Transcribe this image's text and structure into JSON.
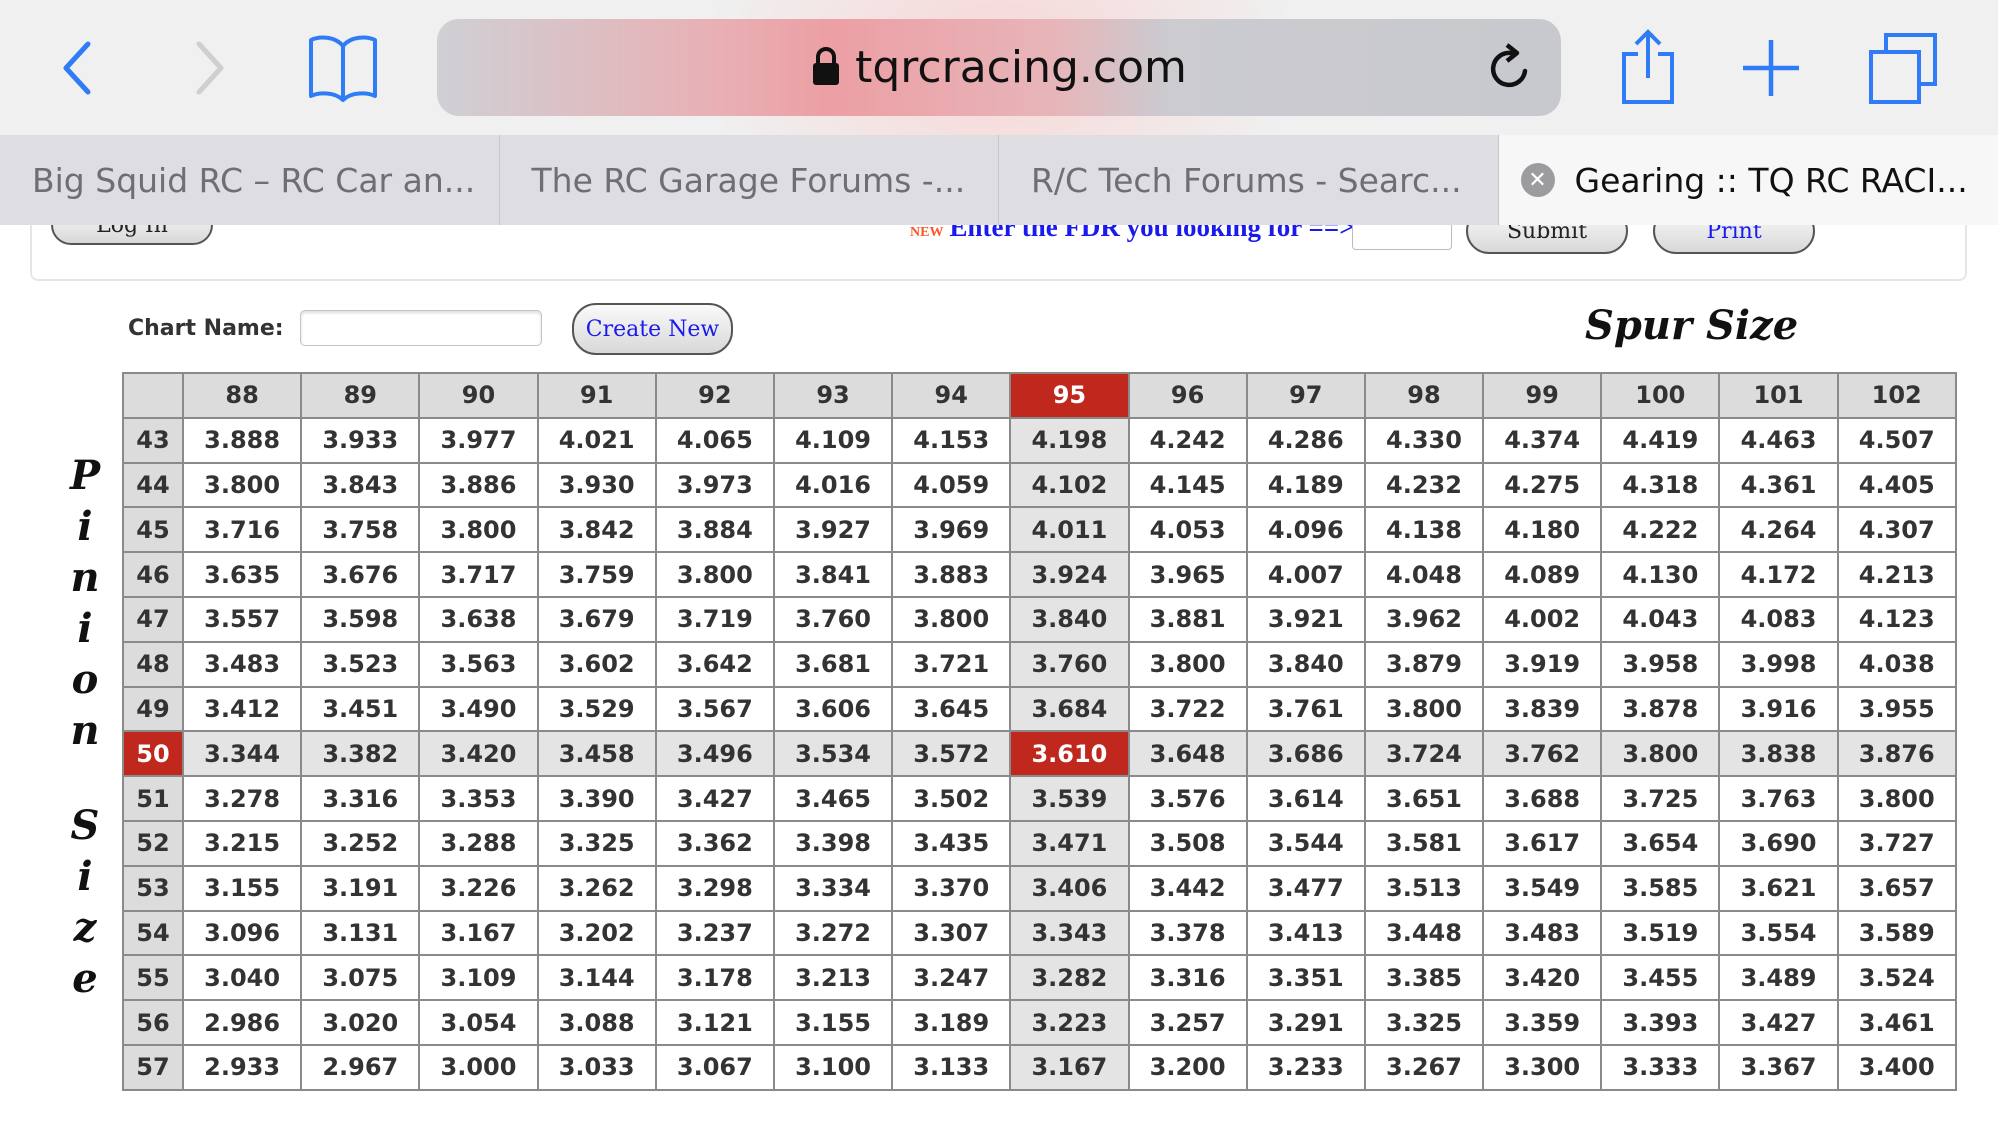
{
  "browser": {
    "url": "tqrcracing.com",
    "icons": [
      "back-icon",
      "forward-icon",
      "bookmarks-icon",
      "lock-icon",
      "reload-icon",
      "share-icon",
      "new-tab-icon",
      "tabs-icon"
    ],
    "tabs": [
      {
        "label": "Big Squid RC – RC Car an..."
      },
      {
        "label": "The RC Garage Forums -..."
      },
      {
        "label": "R/C Tech Forums - Searc..."
      },
      {
        "label": "Gearing :: TQ RC RACI...",
        "active": true
      }
    ]
  },
  "top": {
    "login_label": "Log In",
    "new_badge": "NEW",
    "fdr_prompt": "Enter the FDR you looking for ==>",
    "fdr_value": "",
    "submit_label": "Submit",
    "print_label": "Print"
  },
  "chart_form": {
    "label": "Chart Name:",
    "value": "",
    "create_label": "Create New"
  },
  "table": {
    "spur_title": "Spur Size",
    "pinion_title": [
      "P",
      "i",
      "n",
      "i",
      "o",
      "n",
      "",
      "S",
      "i",
      "z",
      "e"
    ],
    "highlight_color": "#c0281e",
    "selected_spur": "95",
    "selected_pinion": "50",
    "spurs": [
      "88",
      "89",
      "90",
      "91",
      "92",
      "93",
      "94",
      "95",
      "96",
      "97",
      "98",
      "99",
      "100",
      "101",
      "102"
    ],
    "rows": [
      {
        "pinion": "43",
        "values": [
          "3.888",
          "3.933",
          "3.977",
          "4.021",
          "4.065",
          "4.109",
          "4.153",
          "4.198",
          "4.242",
          "4.286",
          "4.330",
          "4.374",
          "4.419",
          "4.463",
          "4.507"
        ]
      },
      {
        "pinion": "44",
        "values": [
          "3.800",
          "3.843",
          "3.886",
          "3.930",
          "3.973",
          "4.016",
          "4.059",
          "4.102",
          "4.145",
          "4.189",
          "4.232",
          "4.275",
          "4.318",
          "4.361",
          "4.405"
        ]
      },
      {
        "pinion": "45",
        "values": [
          "3.716",
          "3.758",
          "3.800",
          "3.842",
          "3.884",
          "3.927",
          "3.969",
          "4.011",
          "4.053",
          "4.096",
          "4.138",
          "4.180",
          "4.222",
          "4.264",
          "4.307"
        ]
      },
      {
        "pinion": "46",
        "values": [
          "3.635",
          "3.676",
          "3.717",
          "3.759",
          "3.800",
          "3.841",
          "3.883",
          "3.924",
          "3.965",
          "4.007",
          "4.048",
          "4.089",
          "4.130",
          "4.172",
          "4.213"
        ]
      },
      {
        "pinion": "47",
        "values": [
          "3.557",
          "3.598",
          "3.638",
          "3.679",
          "3.719",
          "3.760",
          "3.800",
          "3.840",
          "3.881",
          "3.921",
          "3.962",
          "4.002",
          "4.043",
          "4.083",
          "4.123"
        ]
      },
      {
        "pinion": "48",
        "values": [
          "3.483",
          "3.523",
          "3.563",
          "3.602",
          "3.642",
          "3.681",
          "3.721",
          "3.760",
          "3.800",
          "3.840",
          "3.879",
          "3.919",
          "3.958",
          "3.998",
          "4.038"
        ]
      },
      {
        "pinion": "49",
        "values": [
          "3.412",
          "3.451",
          "3.490",
          "3.529",
          "3.567",
          "3.606",
          "3.645",
          "3.684",
          "3.722",
          "3.761",
          "3.800",
          "3.839",
          "3.878",
          "3.916",
          "3.955"
        ]
      },
      {
        "pinion": "50",
        "values": [
          "3.344",
          "3.382",
          "3.420",
          "3.458",
          "3.496",
          "3.534",
          "3.572",
          "3.610",
          "3.648",
          "3.686",
          "3.724",
          "3.762",
          "3.800",
          "3.838",
          "3.876"
        ]
      },
      {
        "pinion": "51",
        "values": [
          "3.278",
          "3.316",
          "3.353",
          "3.390",
          "3.427",
          "3.465",
          "3.502",
          "3.539",
          "3.576",
          "3.614",
          "3.651",
          "3.688",
          "3.725",
          "3.763",
          "3.800"
        ]
      },
      {
        "pinion": "52",
        "values": [
          "3.215",
          "3.252",
          "3.288",
          "3.325",
          "3.362",
          "3.398",
          "3.435",
          "3.471",
          "3.508",
          "3.544",
          "3.581",
          "3.617",
          "3.654",
          "3.690",
          "3.727"
        ]
      },
      {
        "pinion": "53",
        "values": [
          "3.155",
          "3.191",
          "3.226",
          "3.262",
          "3.298",
          "3.334",
          "3.370",
          "3.406",
          "3.442",
          "3.477",
          "3.513",
          "3.549",
          "3.585",
          "3.621",
          "3.657"
        ]
      },
      {
        "pinion": "54",
        "values": [
          "3.096",
          "3.131",
          "3.167",
          "3.202",
          "3.237",
          "3.272",
          "3.307",
          "3.343",
          "3.378",
          "3.413",
          "3.448",
          "3.483",
          "3.519",
          "3.554",
          "3.589"
        ]
      },
      {
        "pinion": "55",
        "values": [
          "3.040",
          "3.075",
          "3.109",
          "3.144",
          "3.178",
          "3.213",
          "3.247",
          "3.282",
          "3.316",
          "3.351",
          "3.385",
          "3.420",
          "3.455",
          "3.489",
          "3.524"
        ]
      },
      {
        "pinion": "56",
        "values": [
          "2.986",
          "3.020",
          "3.054",
          "3.088",
          "3.121",
          "3.155",
          "3.189",
          "3.223",
          "3.257",
          "3.291",
          "3.325",
          "3.359",
          "3.393",
          "3.427",
          "3.461"
        ]
      },
      {
        "pinion": "57",
        "values": [
          "2.933",
          "2.967",
          "3.000",
          "3.033",
          "3.067",
          "3.100",
          "3.133",
          "3.167",
          "3.200",
          "3.233",
          "3.267",
          "3.300",
          "3.333",
          "3.367",
          "3.400"
        ]
      }
    ]
  }
}
